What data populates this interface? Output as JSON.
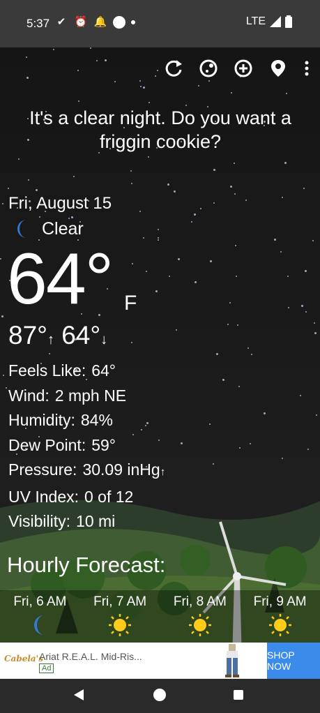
{
  "status_bar": {
    "time": "5:37",
    "network": "LTE",
    "icons": [
      "check-circle-icon",
      "alarm-icon",
      "bell-icon",
      "circle-icon",
      "dot-icon",
      "signal-icon",
      "battery-icon"
    ]
  },
  "toolbar": {
    "buttons": [
      "refresh-icon",
      "moon-phase-icon",
      "add-location-icon",
      "location-pin-icon",
      "more-vert-icon"
    ]
  },
  "headline": "It's a clear night. Do you want a friggin cookie?",
  "current": {
    "date": "Fri, August 15",
    "condition": "Clear",
    "temperature": "64°",
    "unit": "F",
    "high": "87°",
    "low": "64°"
  },
  "details": [
    {
      "label": "Feels Like:",
      "value": "64°"
    },
    {
      "label": "Wind:",
      "value": "2 mph NE"
    },
    {
      "label": "Humidity:",
      "value": "84%"
    },
    {
      "label": "Dew Point:",
      "value": "59°"
    },
    {
      "label": "Pressure:",
      "value": "30.09 inHg"
    },
    {
      "label": "UV Index:",
      "value": "0 of 12"
    },
    {
      "label": "Visibility:",
      "value": "10 mi"
    }
  ],
  "hourly": {
    "title": "Hourly Forecast:",
    "items": [
      {
        "time": "Fri, 6 AM",
        "icon": "moon-icon"
      },
      {
        "time": "Fri, 7 AM",
        "icon": "sun-icon"
      },
      {
        "time": "Fri, 8 AM",
        "icon": "sun-icon"
      },
      {
        "time": "Fri, 9 AM",
        "icon": "sun-icon"
      }
    ]
  },
  "ad": {
    "brand": "Cabela's",
    "title": "Ariat R.E.A.L. Mid-Ris...",
    "badge": "Ad",
    "cta": "SHOP NOW"
  },
  "colors": {
    "moon": "#2f7bd6",
    "sun": "#ffcc1a",
    "ad_cta": "#3b8bea"
  }
}
